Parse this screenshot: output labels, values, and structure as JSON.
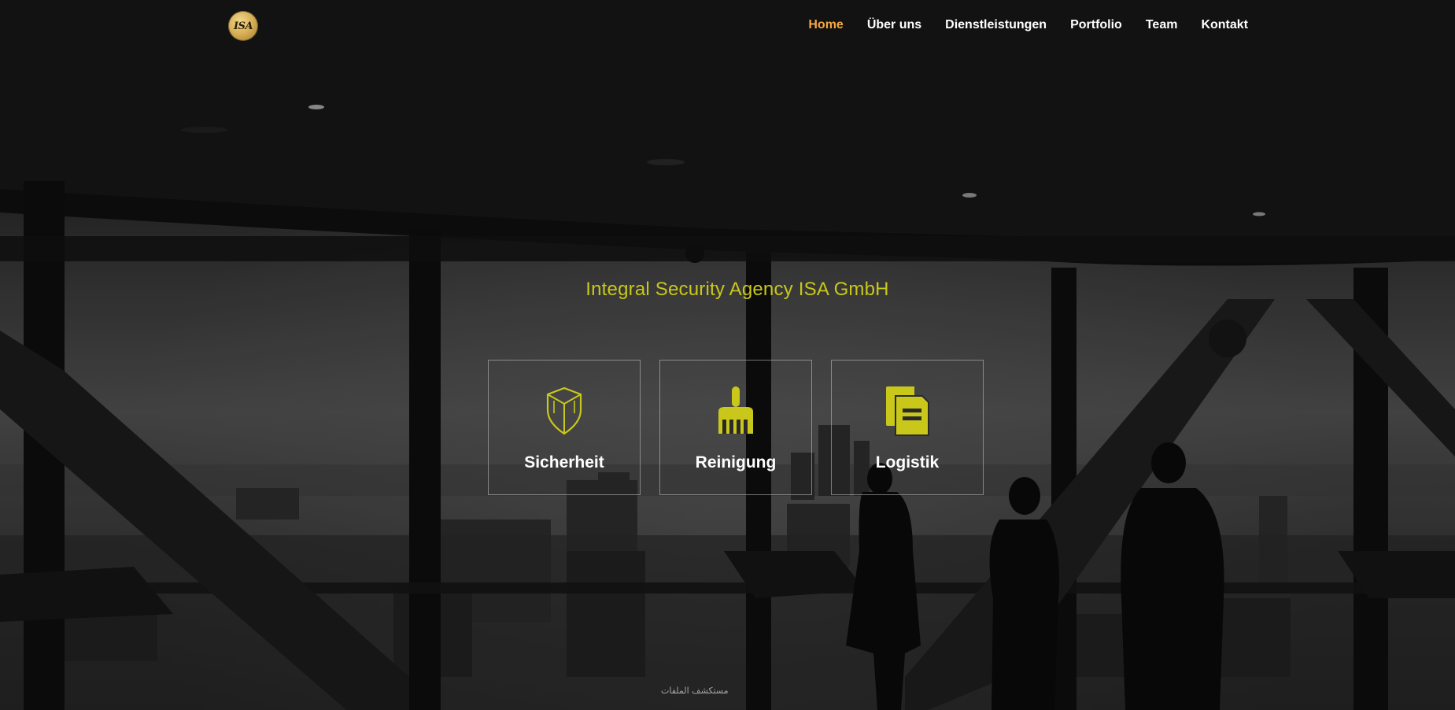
{
  "brand": {
    "logo_text": "ISA"
  },
  "nav": {
    "items": [
      {
        "label": "Home",
        "active": true
      },
      {
        "label": "Über uns",
        "active": false
      },
      {
        "label": "Dienstleistungen",
        "active": false
      },
      {
        "label": "Portfolio",
        "active": false
      },
      {
        "label": "Team",
        "active": false
      },
      {
        "label": "Kontakt",
        "active": false
      }
    ]
  },
  "hero": {
    "headline": "Integral Security Agency ISA GmbH",
    "services": [
      {
        "label": "Sicherheit",
        "icon": "shield-icon"
      },
      {
        "label": "Reinigung",
        "icon": "broom-icon"
      },
      {
        "label": "Logistik",
        "icon": "documents-icon"
      }
    ]
  },
  "footer": {
    "note": "مستكشف الملفات"
  },
  "colors": {
    "accent": "#c9c81a",
    "nav_active": "#f5a742",
    "text": "#ffffff"
  }
}
